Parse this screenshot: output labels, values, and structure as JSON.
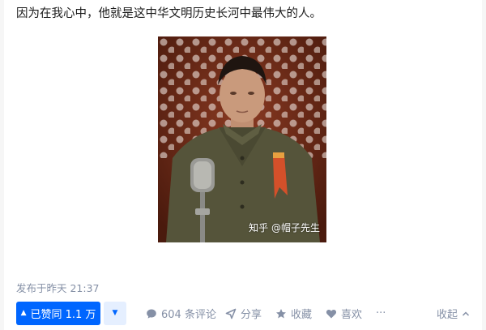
{
  "answer": {
    "text": "因为在我心中，他就是这中华文明历史长河中最伟大的人。",
    "image": {
      "watermark": "知乎 @帽子先生"
    },
    "published": "发布于昨天 21:37"
  },
  "actions": {
    "vote_up_label": "已赞同 1.1 万",
    "vote_down_icon": "triangle-down-icon",
    "comments_label": "604 条评论",
    "share_label": "分享",
    "collect_label": "收藏",
    "like_label": "喜欢",
    "more_label": "···",
    "collapse_label": "收起"
  },
  "colors": {
    "accent": "#0066ff",
    "accent_light": "#e5efff",
    "muted": "#8590a6"
  }
}
